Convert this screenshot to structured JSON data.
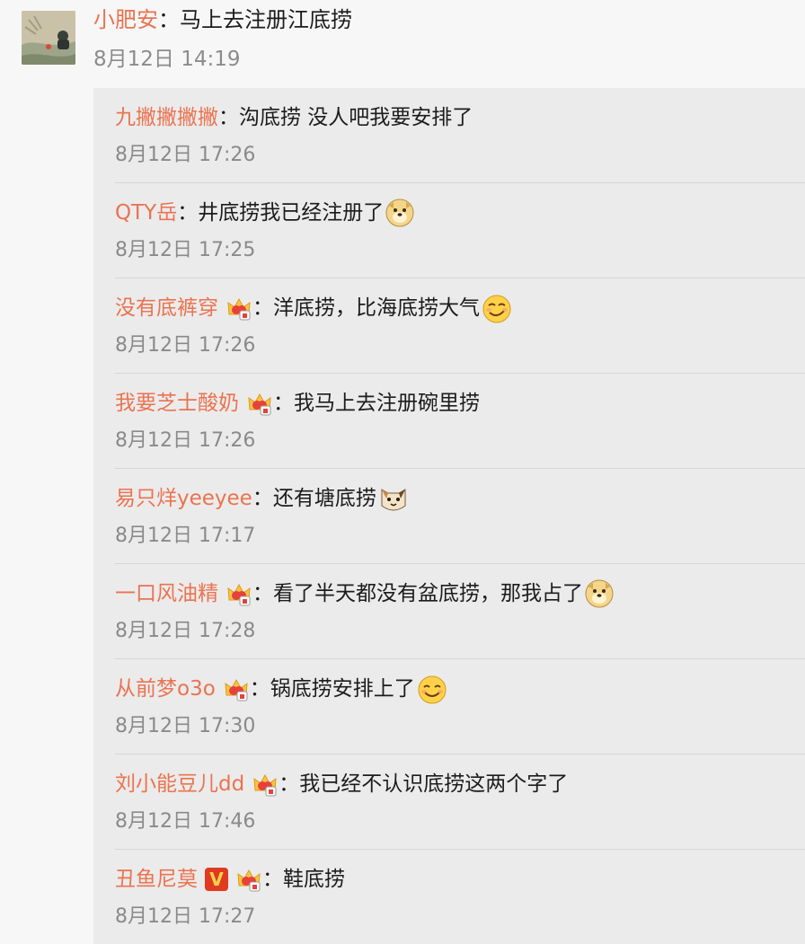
{
  "main_comment": {
    "avatar": "avatar-photo",
    "username": "小肥安",
    "separator": "：",
    "text": "马上去注册江底捞",
    "timestamp": "8月12日 14:19"
  },
  "replies": [
    {
      "username": "九撇撇撇撇",
      "badge": "",
      "separator": "：",
      "text": "沟底捞 没人吧我要安排了",
      "emoji": "",
      "timestamp": "8月12日 17:26"
    },
    {
      "username": "QTY岳",
      "badge": "",
      "separator": "：",
      "text": "井底捞我已经注册了",
      "emoji": "doge-emoji",
      "timestamp": "8月12日 17:25"
    },
    {
      "username": "没有底裤穿",
      "badge": "crown-badge",
      "separator": "：",
      "text": "洋底捞，比海底捞大气",
      "emoji": "smirk-emoji",
      "timestamp": "8月12日 17:26"
    },
    {
      "username": "我要芝士酸奶",
      "badge": "crown-badge",
      "separator": "：",
      "text": "我马上去注册碗里捞",
      "emoji": "",
      "timestamp": "8月12日 17:26"
    },
    {
      "username": "易只烊yeeyee",
      "badge": "",
      "separator": "：",
      "text": "还有塘底捞",
      "emoji": "cat-emoji",
      "timestamp": "8月12日 17:17"
    },
    {
      "username": "一口风油精",
      "badge": "crown-badge",
      "separator": "：",
      "text": "看了半天都没有盆底捞，那我占了",
      "emoji": "doge-emoji",
      "timestamp": "8月12日 17:28"
    },
    {
      "username": "从前梦o3o",
      "badge": "crown-badge",
      "separator": "：",
      "text": "锅底捞安排上了",
      "emoji": "smile-emoji",
      "timestamp": "8月12日 17:30"
    },
    {
      "username": "刘小能豆儿dd",
      "badge": "crown-badge",
      "separator": "：",
      "text": "我已经不认识底捞这两个字了",
      "emoji": "",
      "timestamp": "8月12日 17:46"
    },
    {
      "username": "丑鱼尼莫",
      "badge": "vip-v-badge+crown-badge",
      "separator": "：",
      "text": "鞋底捞",
      "emoji": "",
      "timestamp": "8月12日 17:27"
    }
  ],
  "colors": {
    "username": "#eb7350",
    "text": "#1c1c1c",
    "timestamp": "#8a8a8a",
    "background": "#f7f7f7",
    "reply_panel": "#ebebeb"
  }
}
